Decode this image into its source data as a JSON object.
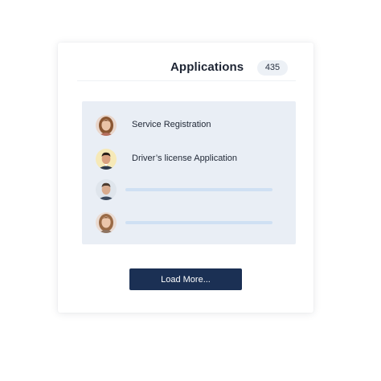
{
  "header": {
    "title": "Applications",
    "count": "435"
  },
  "list": {
    "items": [
      {
        "label": "Service Registration",
        "avatar_icon": "person-avatar-woman-icon"
      },
      {
        "label": "Driver’s license Application",
        "avatar_icon": "person-avatar-man-icon"
      },
      {
        "label": "",
        "avatar_icon": "person-avatar-man-icon",
        "loading": true
      },
      {
        "label": "",
        "avatar_icon": "person-avatar-woman-icon",
        "loading": true
      }
    ]
  },
  "actions": {
    "load_more_label": "Load More..."
  },
  "colors": {
    "accent": "#1b3054",
    "panel_bg": "#e9eef5",
    "badge_bg": "#edf1f6",
    "placeholder_bar": "#cfe0f3"
  }
}
